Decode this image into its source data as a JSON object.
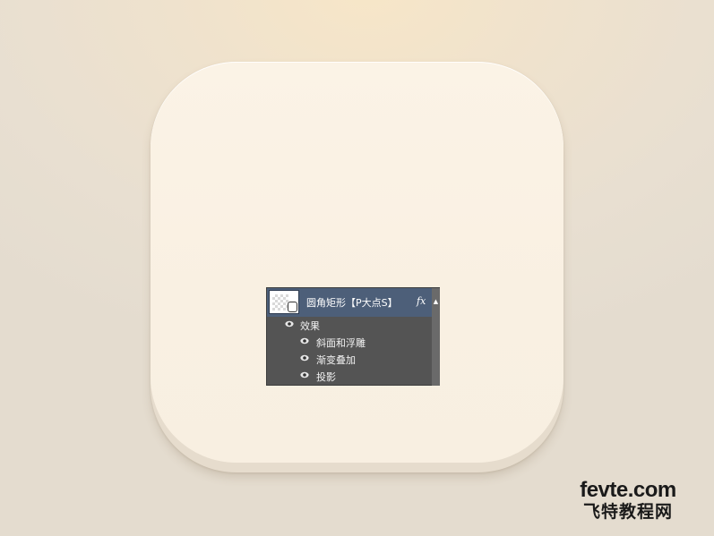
{
  "layers_panel": {
    "layer": {
      "name": "圆角矩形【P大点S】",
      "fx_label": "fx",
      "thumbnail_icon": "rounded-rect-shape-icon"
    },
    "effects_header": "效果",
    "effects": [
      {
        "label": "斜面和浮雕",
        "visible": true
      },
      {
        "label": "渐变叠加",
        "visible": true
      },
      {
        "label": "投影",
        "visible": true
      }
    ],
    "scroll_icon": "scroll-up-arrow-icon"
  },
  "watermark": {
    "line1": "fevte.com",
    "line2": "飞特教程网"
  },
  "colors": {
    "tile_face": "#f9f0e2",
    "panel_bg": "#545454",
    "layer_selected": "#4d5f79"
  }
}
